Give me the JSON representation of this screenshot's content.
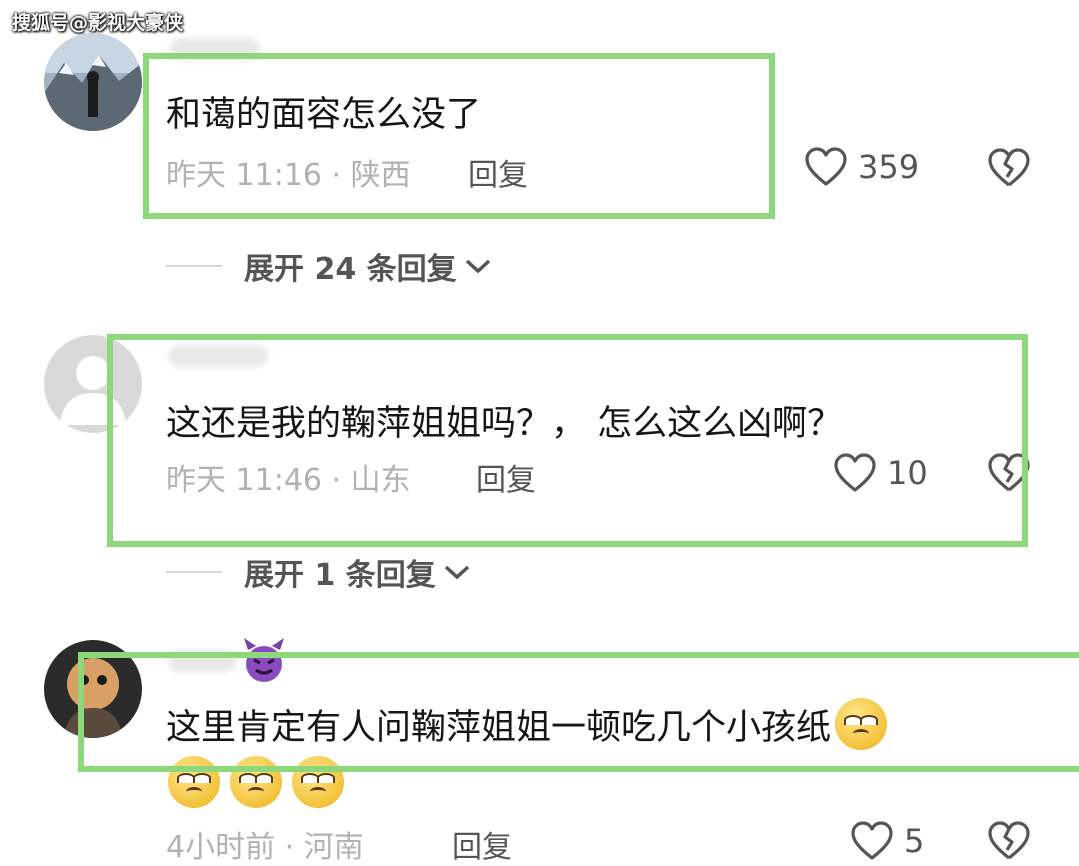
{
  "watermark": "搜狐号@影视大豪侠",
  "comments": [
    {
      "text": "和蔼的面容怎么没了",
      "meta": "昨天 11:16 · 陕西",
      "reply_label": "回复",
      "likes": "359",
      "expand_label": "展开 24 条回复"
    },
    {
      "text": "这还是我的鞠萍姐姐吗？， 怎么这么凶啊？",
      "meta": "昨天 11:46 · 山东",
      "reply_label": "回复",
      "likes": "10",
      "expand_label": "展开 1 条回复"
    },
    {
      "text": "这里肯定有人问鞠萍姐姐一顿吃几个小孩纸",
      "meta": "4小时前 · 河南",
      "reply_label": "回复",
      "likes": "5",
      "emoji_count": 4
    }
  ],
  "colors": {
    "highlight_border": "#8ed87c",
    "meta_text": "#b2b2b2",
    "action_text": "#555555"
  },
  "icons": [
    "heart-outline-icon",
    "broken-heart-icon",
    "chevron-down-icon",
    "rolling-eyes-emoji"
  ]
}
